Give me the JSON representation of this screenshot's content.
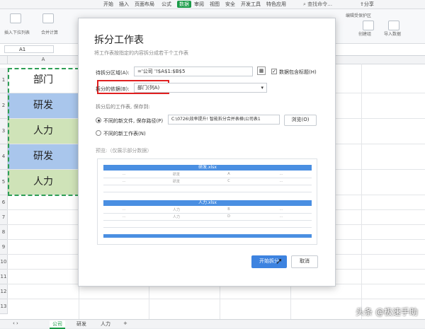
{
  "menu": {
    "items": [
      "开始",
      "插入",
      "页面布局",
      "公式",
      "数据",
      "审阅",
      "视图",
      "安全",
      "开发工具",
      "特色应用"
    ],
    "active": "数据",
    "search": "查找命令…",
    "share": "分享"
  },
  "ribbon": {
    "left_labels": [
      "插入下拉列表",
      "合并计算"
    ],
    "right_labels": [
      "编辑受保护区",
      "创建组",
      "取消组合",
      "分级显示",
      "导入数据"
    ]
  },
  "namebox": "A1",
  "grid": {
    "col_header": "A",
    "rows": [
      "1",
      "2",
      "3",
      "4",
      "5",
      "6",
      "7",
      "8",
      "9",
      "10",
      "11",
      "12",
      "13",
      "14"
    ],
    "cells": [
      "部门",
      "研发",
      "人力",
      "研发",
      "人力"
    ],
    "cell_colors": [
      "#ffffff",
      "#a9c6ec",
      "#cfe3b8",
      "#a9c6ec",
      "#cfe3b8"
    ]
  },
  "sheet_tabs": [
    "公司",
    "研发",
    "人力",
    "+"
  ],
  "dialog": {
    "title": "拆分工作表",
    "subtitle": "将工作表按指定的内容拆分成若干个工作表",
    "area_label": "待拆分区域(A):",
    "area_value": "='公司 '!$A$1:$B$5",
    "include_header": "数据包含标题(H)",
    "basis_label": "拆分的依据(B):",
    "basis_value": "部门(列A)",
    "after_label": "拆分后的工作表, 保存到:",
    "option_new_file": "不同的新文件, 保存路径(P)",
    "path_value": "C:\\0726\\效率提升! 智能拆分合并表格\\公司表1",
    "browse": "浏览(O)",
    "option_new_sheet": "不同的新工作表(N)",
    "preview_label": "预览:（仅展示部分数据）",
    "preview": [
      {
        "title": "研发.xlsx",
        "rows": [
          [
            "…",
            "研发",
            "A",
            "…"
          ],
          [
            "…",
            "研发",
            "C",
            "…"
          ]
        ]
      },
      {
        "title": "人力.xlsx",
        "rows": [
          [
            "…",
            "人力",
            "B",
            "…"
          ],
          [
            "…",
            "人力",
            "D",
            "…"
          ]
        ]
      }
    ],
    "start_btn": "开始拆分",
    "cancel_btn": "取消"
  },
  "watermark": "头条 @极速手助",
  "colors": {
    "accent": "#1a9b48",
    "primary": "#3d83e0",
    "highlight": "#e02020"
  }
}
